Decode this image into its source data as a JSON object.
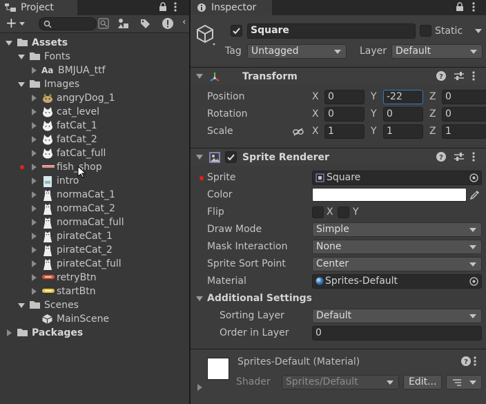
{
  "project": {
    "tab_label": "Project",
    "add_label": "+",
    "tree": [
      {
        "label": "Assets",
        "depth": 0,
        "expanded": true,
        "icon": "folder-icon",
        "bold": true
      },
      {
        "label": "Fonts",
        "depth": 1,
        "expanded": true,
        "icon": "folder-icon"
      },
      {
        "label": "BMJUA_ttf",
        "depth": 2,
        "expanded": false,
        "icon": "font-icon"
      },
      {
        "label": "Images",
        "depth": 1,
        "expanded": true,
        "icon": "folder-icon"
      },
      {
        "label": "angryDog_1",
        "depth": 2,
        "expanded": false,
        "icon": "sprite-dog-icon"
      },
      {
        "label": "cat_level",
        "depth": 2,
        "expanded": false,
        "icon": "sprite-cat-icon"
      },
      {
        "label": "fatCat_1",
        "depth": 2,
        "expanded": false,
        "icon": "sprite-cat-icon"
      },
      {
        "label": "fatCat_2",
        "depth": 2,
        "expanded": false,
        "icon": "sprite-cat-icon"
      },
      {
        "label": "fatCat_full",
        "depth": 2,
        "expanded": false,
        "icon": "sprite-cat-icon"
      },
      {
        "label": "fish_shop",
        "depth": 2,
        "expanded": false,
        "icon": "sprite-bar-icon",
        "marked": true
      },
      {
        "label": "intro",
        "depth": 2,
        "expanded": false,
        "icon": "sprite-intro-icon"
      },
      {
        "label": "normaCat_1",
        "depth": 2,
        "expanded": false,
        "icon": "sprite-cat-standing-icon"
      },
      {
        "label": "normaCat_2",
        "depth": 2,
        "expanded": false,
        "icon": "sprite-cat-standing-icon"
      },
      {
        "label": "normaCat_full",
        "depth": 2,
        "expanded": false,
        "icon": "sprite-cat-standing-icon"
      },
      {
        "label": "pirateCat_1",
        "depth": 2,
        "expanded": false,
        "icon": "sprite-cat-standing-icon"
      },
      {
        "label": "pirateCat_2",
        "depth": 2,
        "expanded": false,
        "icon": "sprite-cat-standing-icon"
      },
      {
        "label": "pirateCat_full",
        "depth": 2,
        "expanded": false,
        "icon": "sprite-cat-standing-icon"
      },
      {
        "label": "retryBtn",
        "depth": 2,
        "expanded": false,
        "icon": "sprite-button-red-icon"
      },
      {
        "label": "startBtn",
        "depth": 2,
        "expanded": false,
        "icon": "sprite-button-yellow-icon"
      },
      {
        "label": "Scenes",
        "depth": 1,
        "expanded": true,
        "icon": "folder-icon"
      },
      {
        "label": "MainScene",
        "depth": 2,
        "expanded": null,
        "icon": "unity-scene-icon"
      },
      {
        "label": "Packages",
        "depth": 0,
        "expanded": false,
        "icon": "folder-icon",
        "bold": true
      }
    ]
  },
  "inspector": {
    "tab_label": "Inspector",
    "object": {
      "name": "Square",
      "active": true,
      "static_label": "Static",
      "tag_label": "Tag",
      "tag_value": "Untagged",
      "layer_label": "Layer",
      "layer_value": "Default"
    },
    "transform": {
      "title": "Transform",
      "rows": [
        {
          "label": "Position",
          "x": "0",
          "y": "-22",
          "z": "0"
        },
        {
          "label": "Rotation",
          "x": "0",
          "y": "0",
          "z": "0"
        },
        {
          "label": "Scale",
          "x": "1",
          "y": "1",
          "z": "1"
        }
      ],
      "axis_x": "X",
      "axis_y": "Y",
      "axis_z": "Z"
    },
    "sprite_renderer": {
      "title": "Sprite Renderer",
      "enabled": true,
      "sprite_label": "Sprite",
      "sprite_value": "Square",
      "color_label": "Color",
      "color_value": "#ffffff",
      "flip_label": "Flip",
      "flip_x": "X",
      "flip_y": "Y",
      "draw_mode_label": "Draw Mode",
      "draw_mode_value": "Simple",
      "mask_label": "Mask Interaction",
      "mask_value": "None",
      "sort_point_label": "Sprite Sort Point",
      "sort_point_value": "Center",
      "material_label": "Material",
      "material_value": "Sprites-Default",
      "additional_title": "Additional Settings",
      "sorting_layer_label": "Sorting Layer",
      "sorting_layer_value": "Default",
      "order_label": "Order in Layer",
      "order_value": "0"
    },
    "material": {
      "title": "Sprites-Default (Material)",
      "shader_label": "Shader",
      "shader_value": "Sprites/Default",
      "edit_label": "Edit..."
    }
  },
  "colors": {
    "panel_bg": "#383838",
    "inspector_bg": "#3c3c3c",
    "field_bg": "#2a2a2a",
    "focus_border": "#3a79bb",
    "marker_red": "#e81e1e"
  }
}
